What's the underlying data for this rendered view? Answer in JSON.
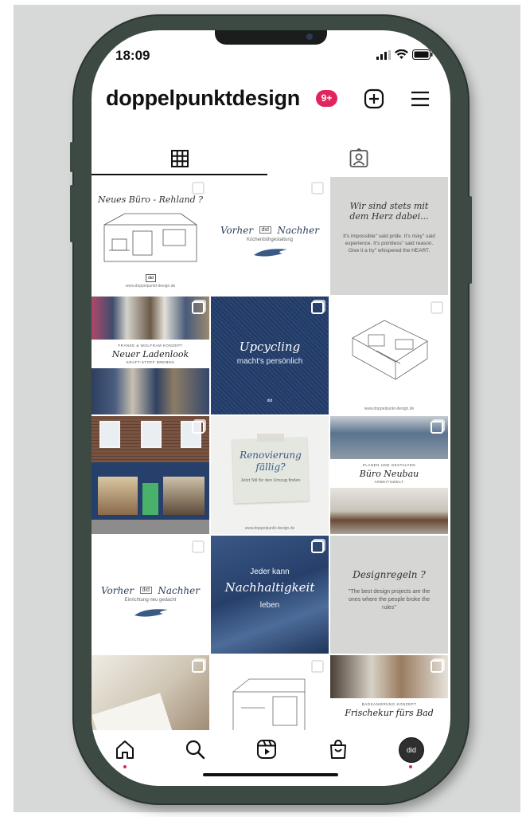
{
  "status_bar": {
    "time": "18:09"
  },
  "header": {
    "username": "doppelpunktdesign",
    "badge": "9+"
  },
  "tabs": [
    {
      "name": "grid",
      "icon": "grid-icon"
    },
    {
      "name": "tagged",
      "icon": "tagged-person-icon"
    }
  ],
  "posts": [
    {
      "title": "Neues Büro - Rehland ?",
      "footer": "www.doppelpunkt-design.de"
    },
    {
      "title": "Vorher",
      "logo": "did",
      "title2": "Nachher",
      "subtitle": "Küchenbühgestaltung"
    },
    {
      "title": "Wir sind stets mit dem Herz dabei...",
      "body": "It's impossible\" said pride. It's risky\" said experience. It's pointless\" said reason. Give it a try\" whispered the HEART."
    },
    {
      "kicker": "FRANKE & WOLFRAM KONZEPT",
      "title": "Neuer Ladenlook",
      "subtitle": "KRAFT-STOFF BREMEN"
    },
    {
      "title": "Upcycling",
      "subtitle": "macht's persönlich",
      "logo": "did"
    },
    {
      "title": "",
      "footer": "www.doppelpunkt-design.de"
    },
    {
      "title": "",
      "footer": ""
    },
    {
      "title": "Renovierung fällig?",
      "subtitle": "Jetzt Stil für den Umzug finden",
      "footer": "www.doppelpunkt-design.de"
    },
    {
      "kicker": "PLANEN UND GESTALTEN",
      "title": "Büro Neubau",
      "subtitle": "ARBEITSWELT"
    },
    {
      "title": "Vorher",
      "logo": "did",
      "title2": "Nachher",
      "subtitle": "Einrichtung neu gedacht"
    },
    {
      "pre": "Jeder kann",
      "title": "Nachhaltigkeit",
      "subtitle": "leben"
    },
    {
      "title": "Designregeln ?",
      "body": "\"The best design projects are the ones where the people broke the rules\""
    },
    {
      "title": "",
      "footer": ""
    },
    {
      "title": "",
      "footer": ""
    },
    {
      "kicker": "BADSANIERUNG KONZEPT",
      "title": "Frischekur fürs Bad",
      "subtitle": ""
    }
  ],
  "bottom_nav": [
    {
      "name": "home",
      "icon": "home-icon"
    },
    {
      "name": "search",
      "icon": "search-icon"
    },
    {
      "name": "reels",
      "icon": "reels-icon"
    },
    {
      "name": "shop",
      "icon": "shop-bag-icon"
    },
    {
      "name": "profile",
      "icon": "profile-avatar-icon",
      "label": "did"
    }
  ],
  "colors": {
    "badge": "#e0245e",
    "denim": "#27406b",
    "accent_blue": "#3a5a86"
  }
}
